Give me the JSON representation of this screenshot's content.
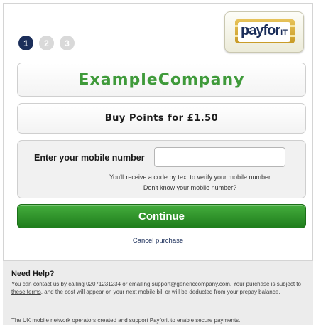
{
  "steps": [
    "1",
    "2",
    "3"
  ],
  "logo": {
    "pay": "pay",
    "for": "for",
    "it": "IT"
  },
  "merchant": {
    "name": "ExampleCompany"
  },
  "purchase": {
    "label": "Buy Points for £1.50"
  },
  "mobile": {
    "label": "Enter your mobile number",
    "value": "",
    "sms_note": "You'll receive a code by text to verify your mobile number",
    "dont_know_link": "Don't know your mobile number",
    "dont_know_suffix": "?"
  },
  "actions": {
    "continue_label": "Continue",
    "cancel_label": "Cancel purchase"
  },
  "help": {
    "title": "Need Help?",
    "contact_prefix": "You can contact us by calling 02071231234 or emailing ",
    "support_email": "support@genericcompany.com",
    "contact_mid": ". Your purchase is subject to ",
    "terms_link": "these terms",
    "contact_suffix": ", and the cost will appear on your next mobile bill or will be deducted from your prepay balance.",
    "footer": "The UK mobile network operators created and support Payforit to enable secure payments."
  },
  "colors": {
    "brand_navy": "#1b2e5a",
    "merchant_green": "#3f9a3a",
    "continue_green": "#2e9428"
  }
}
